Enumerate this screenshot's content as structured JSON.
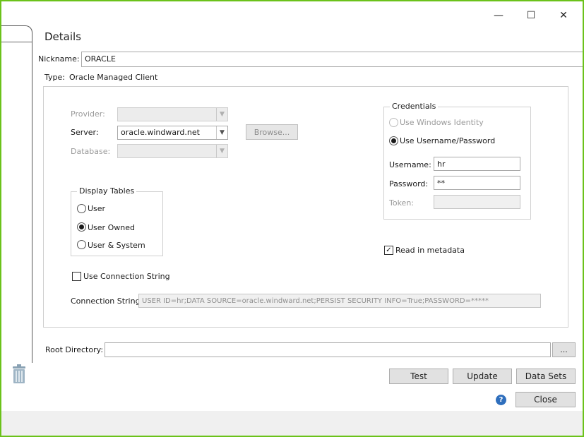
{
  "window": {
    "minimize_glyph": "—",
    "maximize_glyph": "☐",
    "close_glyph": "✕"
  },
  "details": {
    "heading": "Details",
    "nickname_label": "Nickname:",
    "nickname_value": "ORACLE",
    "type_label": "Type:",
    "type_value": "Oracle Managed Client"
  },
  "connection": {
    "provider_label": "Provider:",
    "provider_value": "",
    "server_label": "Server:",
    "server_value": "oracle.windward.net",
    "database_label": "Database:",
    "database_value": "",
    "browse_label": "Browse..."
  },
  "display_tables": {
    "legend": "Display Tables",
    "options": [
      {
        "label": "User",
        "checked": false
      },
      {
        "label": "User Owned",
        "checked": true
      },
      {
        "label": "User & System",
        "checked": false
      }
    ]
  },
  "credentials": {
    "legend": "Credentials",
    "windows_identity_label": "Use Windows Identity",
    "windows_identity_checked": false,
    "username_password_label": "Use Username/Password",
    "username_password_checked": true,
    "username_label": "Username:",
    "username_value": "hr",
    "password_label": "Password:",
    "password_value": "**",
    "token_label": "Token:",
    "token_value": ""
  },
  "read_metadata": {
    "label": "Read in metadata",
    "checked": true
  },
  "use_connection_string": {
    "label": "Use Connection String",
    "checked": false
  },
  "connection_string": {
    "label": "Connection String:",
    "value": "USER ID=hr;DATA SOURCE=oracle.windward.net;PERSIST SECURITY INFO=True;PASSWORD=*****"
  },
  "root_directory": {
    "label": "Root Directory:",
    "value": "",
    "browse_label": "..."
  },
  "buttons": {
    "test": "Test",
    "update": "Update",
    "data_sets": "Data Sets",
    "close": "Close",
    "help_glyph": "?"
  },
  "icons": {
    "trash": "trash-icon",
    "help": "help-icon",
    "dropdown": "chevron-down-icon"
  },
  "colors": {
    "window_border": "#6bc21a",
    "help_icon": "#2f6fbd",
    "trash_icon": "#8aa2b4"
  }
}
